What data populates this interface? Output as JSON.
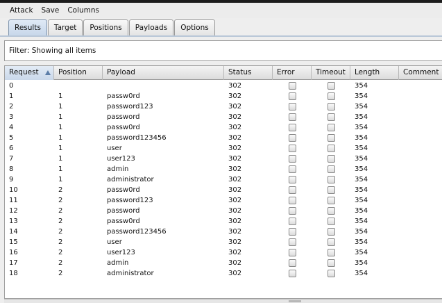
{
  "menu": [
    "Attack",
    "Save",
    "Columns"
  ],
  "tabs": [
    {
      "label": "Results",
      "active": true
    },
    {
      "label": "Target",
      "active": false
    },
    {
      "label": "Positions",
      "active": false
    },
    {
      "label": "Payloads",
      "active": false
    },
    {
      "label": "Options",
      "active": false
    }
  ],
  "filter": {
    "text": "Filter: Showing all items"
  },
  "table": {
    "columns": [
      "Request",
      "Position",
      "Payload",
      "Status",
      "Error",
      "Timeout",
      "Length",
      "Comment"
    ],
    "sorted_column": "Request",
    "sort_direction": "ascending",
    "rows": [
      {
        "request": "0",
        "position": "",
        "payload": "",
        "status": "302",
        "length": "354"
      },
      {
        "request": "1",
        "position": "1",
        "payload": "passw0rd",
        "status": "302",
        "length": "354"
      },
      {
        "request": "2",
        "position": "1",
        "payload": "password123",
        "status": "302",
        "length": "354"
      },
      {
        "request": "3",
        "position": "1",
        "payload": "password",
        "status": "302",
        "length": "354"
      },
      {
        "request": "4",
        "position": "1",
        "payload": "passw0rd",
        "status": "302",
        "length": "354"
      },
      {
        "request": "5",
        "position": "1",
        "payload": "password123456",
        "status": "302",
        "length": "354"
      },
      {
        "request": "6",
        "position": "1",
        "payload": "user",
        "status": "302",
        "length": "354"
      },
      {
        "request": "7",
        "position": "1",
        "payload": "user123",
        "status": "302",
        "length": "354"
      },
      {
        "request": "8",
        "position": "1",
        "payload": "admin",
        "status": "302",
        "length": "354"
      },
      {
        "request": "9",
        "position": "1",
        "payload": "administrator",
        "status": "302",
        "length": "354"
      },
      {
        "request": "10",
        "position": "2",
        "payload": "passw0rd",
        "status": "302",
        "length": "354"
      },
      {
        "request": "11",
        "position": "2",
        "payload": "password123",
        "status": "302",
        "length": "354"
      },
      {
        "request": "12",
        "position": "2",
        "payload": "password",
        "status": "302",
        "length": "354"
      },
      {
        "request": "13",
        "position": "2",
        "payload": "passw0rd",
        "status": "302",
        "length": "354"
      },
      {
        "request": "14",
        "position": "2",
        "payload": "password123456",
        "status": "302",
        "length": "354"
      },
      {
        "request": "15",
        "position": "2",
        "payload": "user",
        "status": "302",
        "length": "354"
      },
      {
        "request": "16",
        "position": "2",
        "payload": "user123",
        "status": "302",
        "length": "354"
      },
      {
        "request": "17",
        "position": "2",
        "payload": "admin",
        "status": "302",
        "length": "354"
      },
      {
        "request": "18",
        "position": "2",
        "payload": "administrator",
        "status": "302",
        "length": "354"
      }
    ]
  },
  "colors": {
    "active_tab": "#c7d7ea",
    "sort_arrow": "#5b7da8"
  }
}
